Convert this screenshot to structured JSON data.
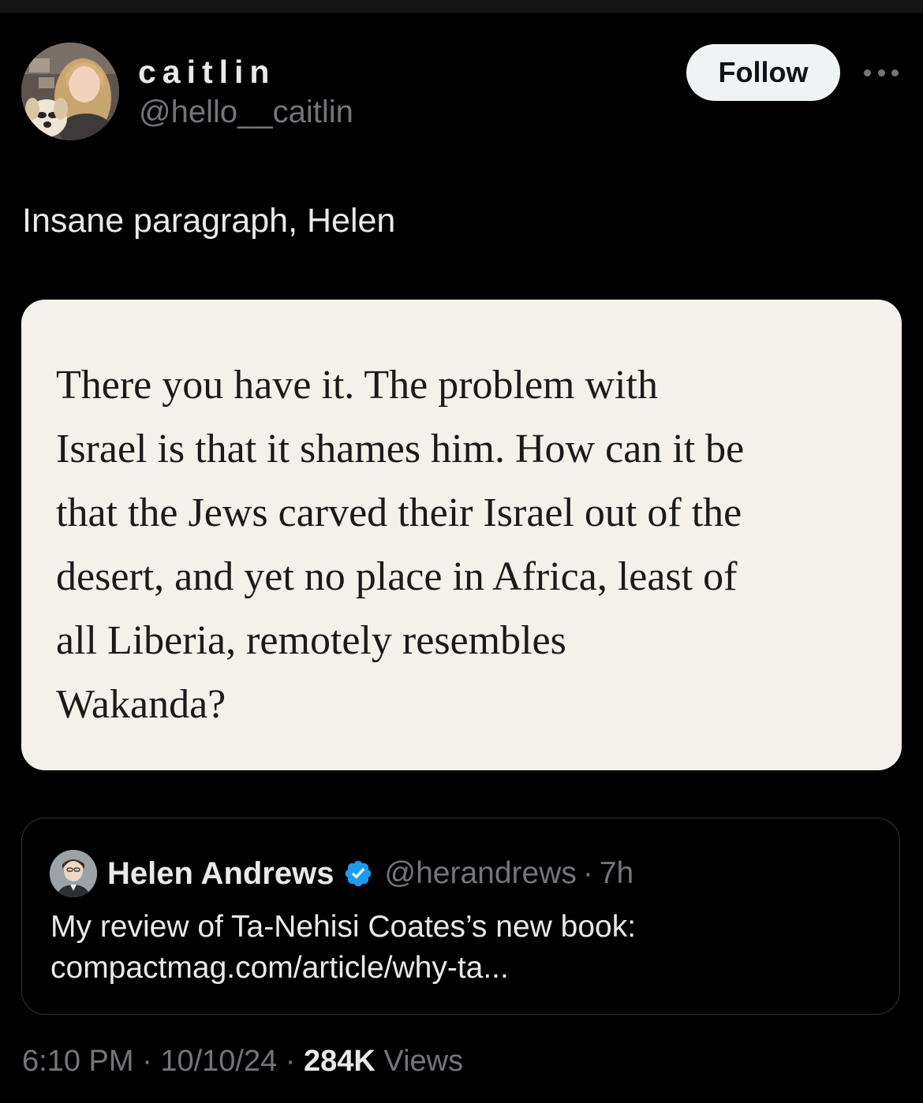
{
  "author": {
    "display_name": "caitlin",
    "handle": "@hello__caitlin",
    "avatar": "profile-photo-woman-with-dog"
  },
  "follow_label": "Follow",
  "more_icon": "more-horizontal-icon",
  "tweet": {
    "text": "Insane paragraph, Helen",
    "image_text_lines": [
      "There you have it. The problem with",
      "Israel is that it shames him. How can it be",
      "that the Jews carved their Israel out of the",
      "desert, and yet no place in Africa, least of",
      "all Liberia, remotely resembles",
      "Wakanda?"
    ]
  },
  "quoted": {
    "name": "Helen Andrews",
    "verified_icon": "verified-badge-icon",
    "handle": "@herandrews",
    "separator": "·",
    "time": "7h",
    "body_line1": "My review of Ta-Nehisi Coates’s new book:",
    "body_line2": "compactmag.com/article/why-ta..."
  },
  "meta": {
    "time": "6:10 PM",
    "sep1": " · ",
    "date": "10/10/24",
    "sep2": " · ",
    "views_count": "284K",
    "views_label": " Views"
  },
  "colors": {
    "background": "#000000",
    "text_primary": "#e7e9ea",
    "text_secondary": "#71767b",
    "verified_blue": "#1d9bf0",
    "image_background": "#f4f1eb"
  }
}
